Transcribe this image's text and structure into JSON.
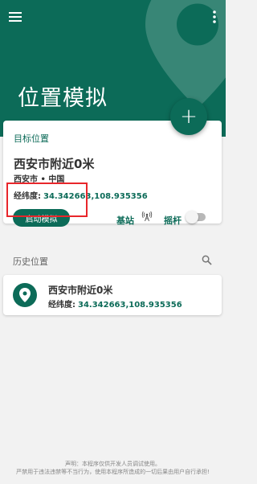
{
  "header": {
    "title": "位置模拟",
    "menu_icon": "hamburger-menu-icon",
    "more_icon": "more-vert-icon",
    "fab_symbol": "+",
    "brand_color": "#0c6b58"
  },
  "target": {
    "label": "目标位置",
    "place_name": "西安市附近0米",
    "region": "西安市 • 中国",
    "coords_label": "经纬度:",
    "coords_value": "34.342663,108.935356",
    "start_button": "启动模拟",
    "station_label": "基站",
    "station_icon": "antenna-icon",
    "joystick_label": "摇杆",
    "joystick_enabled": false
  },
  "history": {
    "header": "历史位置",
    "search_icon": "search-icon",
    "items": [
      {
        "name": "西安市附近0米",
        "coords_label": "经纬度:",
        "coords_value": "34.342663,108.935356",
        "icon": "location-pin-icon"
      }
    ]
  },
  "footer": {
    "line1": "声明：本程序仅供开发人员调试使用。",
    "line2": "严禁用于违法违禁等不当行为，使用本程序所造成的一切后果由用户自行承担!"
  }
}
